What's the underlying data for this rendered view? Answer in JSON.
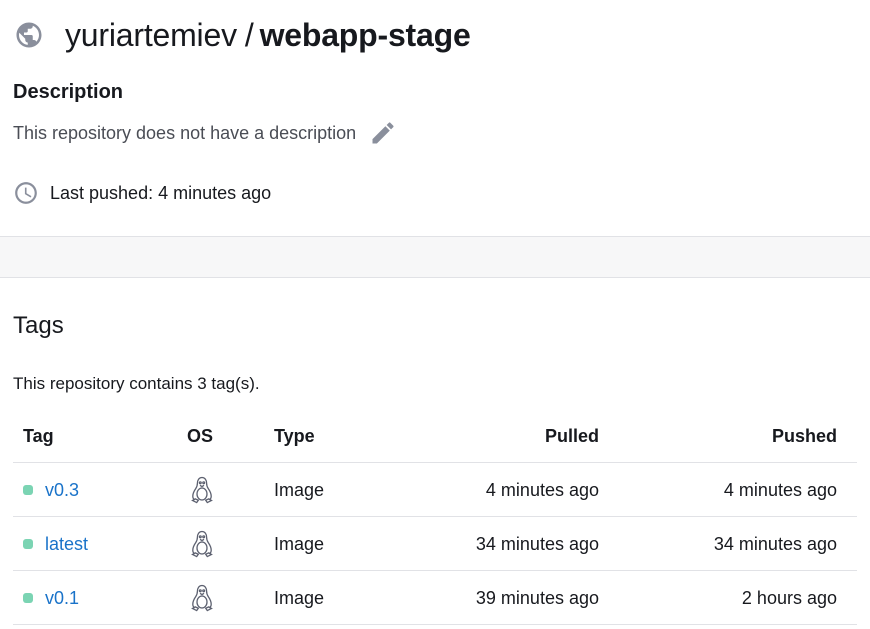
{
  "repo": {
    "owner": "yuriartemiev",
    "separator": "/",
    "name": "webapp-stage",
    "icon": "globe-icon"
  },
  "description": {
    "label": "Description",
    "text": "This repository does not have a description",
    "edit_icon": "pencil-icon"
  },
  "last_pushed": {
    "icon": "clock-icon",
    "text": "Last pushed: 4 minutes ago"
  },
  "tags": {
    "heading": "Tags",
    "count_text": "This repository contains 3 tag(s).",
    "columns": {
      "tag": "Tag",
      "os": "OS",
      "type": "Type",
      "pulled": "Pulled",
      "pushed": "Pushed"
    },
    "rows": [
      {
        "tag": "v0.3",
        "os_icon": "linux-icon",
        "type": "Image",
        "pulled": "4 minutes ago",
        "pushed": "4 minutes ago"
      },
      {
        "tag": "latest",
        "os_icon": "linux-icon",
        "type": "Image",
        "pulled": "34 minutes ago",
        "pushed": "34 minutes ago"
      },
      {
        "tag": "v0.1",
        "os_icon": "linux-icon",
        "type": "Image",
        "pulled": "39 minutes ago",
        "pushed": "2 hours ago"
      }
    ]
  },
  "colors": {
    "link": "#1a73c9",
    "status_dot": "#7bd4b3",
    "icon_gray": "#8a8f9c"
  }
}
